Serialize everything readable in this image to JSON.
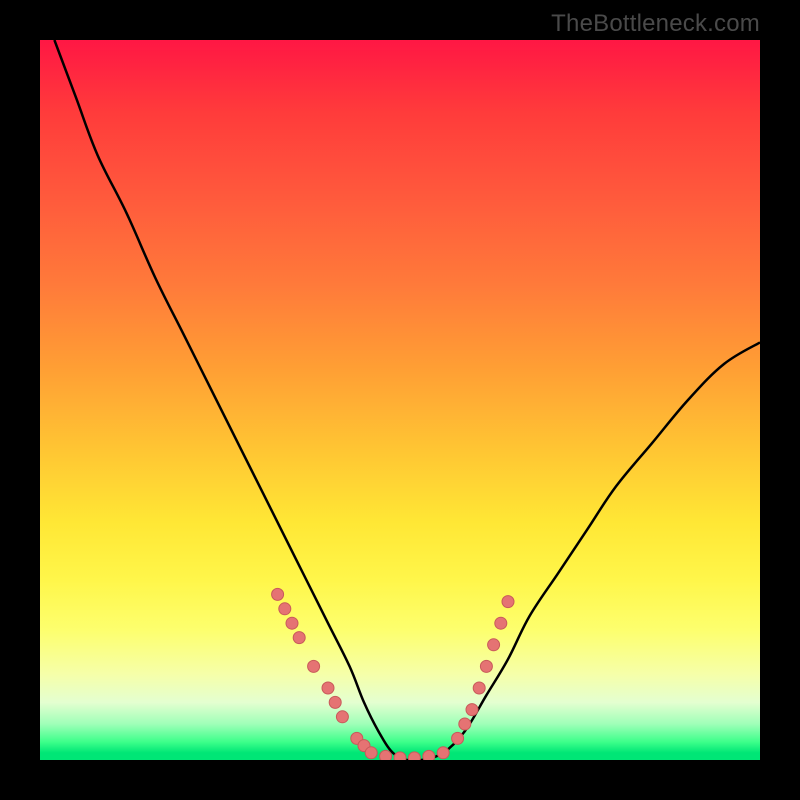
{
  "watermark": "TheBottleneck.com",
  "colors": {
    "curve_stroke": "#000000",
    "dot_fill": "#e57373",
    "dot_stroke": "#c85a5a"
  },
  "chart_data": {
    "type": "line",
    "title": "",
    "xlabel": "",
    "ylabel": "",
    "xlim": [
      0,
      100
    ],
    "ylim": [
      0,
      100
    ],
    "series": [
      {
        "name": "bottleneck-curve",
        "x": [
          2,
          5,
          8,
          12,
          16,
          20,
          24,
          28,
          31,
          34,
          37,
          40,
          43,
          45,
          47,
          49,
          51,
          53,
          56,
          59,
          62,
          65,
          68,
          72,
          76,
          80,
          85,
          90,
          95,
          100
        ],
        "y": [
          100,
          92,
          84,
          76,
          67,
          59,
          51,
          43,
          37,
          31,
          25,
          19,
          13,
          8,
          4,
          1,
          0,
          0,
          1,
          4,
          9,
          14,
          20,
          26,
          32,
          38,
          44,
          50,
          55,
          58
        ]
      }
    ],
    "dots_left": [
      [
        33,
        23
      ],
      [
        34,
        21
      ],
      [
        35,
        19
      ],
      [
        36,
        17
      ],
      [
        38,
        13
      ],
      [
        40,
        10
      ],
      [
        41,
        8
      ],
      [
        42,
        6
      ],
      [
        44,
        3
      ],
      [
        45,
        2
      ]
    ],
    "dots_flat": [
      [
        46,
        1
      ],
      [
        48,
        0.5
      ],
      [
        50,
        0.3
      ],
      [
        52,
        0.3
      ],
      [
        54,
        0.5
      ],
      [
        56,
        1
      ]
    ],
    "dots_right": [
      [
        58,
        3
      ],
      [
        59,
        5
      ],
      [
        60,
        7
      ],
      [
        61,
        10
      ],
      [
        62,
        13
      ],
      [
        63,
        16
      ],
      [
        64,
        19
      ],
      [
        65,
        22
      ]
    ]
  }
}
